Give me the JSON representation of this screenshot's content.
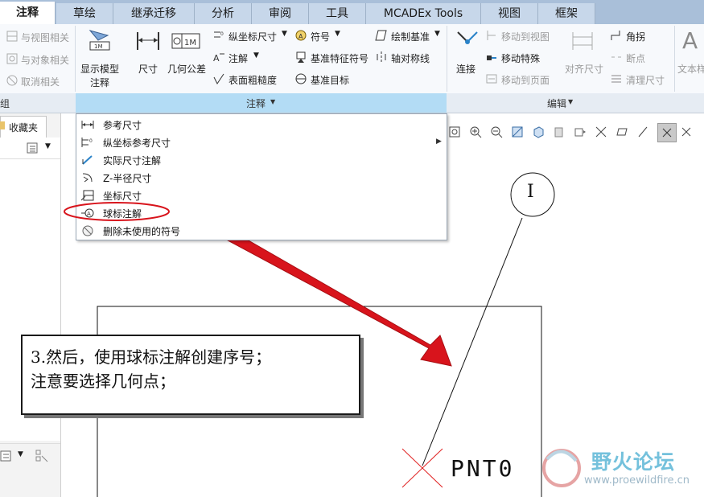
{
  "tabs": [
    "注释",
    "草绘",
    "继承迁移",
    "分析",
    "审阅",
    "工具",
    "MCADEx Tools",
    "视图",
    "框架"
  ],
  "ribbon": {
    "left_items": [
      "与视图相关",
      "与对象相关",
      "取消相关"
    ],
    "annot_group": {
      "show_model": [
        "显示模型",
        "注释"
      ],
      "dimension": "尺寸",
      "gtol": "几何公差",
      "ordinate": "纵坐标尺寸",
      "note": "注解",
      "surface_finish": "表面粗糙度",
      "symbol": "符号",
      "datum_feature": "基准特征符号",
      "datum_target": "基准目标",
      "sketch_datum": "绘制基准",
      "axis_sym": "轴对称线",
      "group_label": "注释"
    },
    "edit_group": {
      "connect": "连接",
      "move_to_view": "移动到视图",
      "move_special": "移动特殊",
      "move_to_page": "移动到页面",
      "align_dim": "对齐尺寸",
      "corner": "角拐",
      "breakpoint": "断点",
      "cleanup_dim": "清理尺寸",
      "text_style": "文本样",
      "group_label": "编辑"
    }
  },
  "left_panel": {
    "tab": "收藏夹",
    "left_group_label": "组"
  },
  "menu": {
    "items": [
      {
        "label": "参考尺寸",
        "icon": "reference-dimension-icon"
      },
      {
        "label": "纵坐标参考尺寸",
        "icon": "ordinate-reference-icon",
        "submenu": true
      },
      {
        "label": "实际尺寸注解",
        "icon": "actual-dimension-icon"
      },
      {
        "label": "Z-半径尺寸",
        "icon": "z-radius-icon"
      },
      {
        "label": "坐标尺寸",
        "icon": "coordinate-dimension-icon"
      },
      {
        "label": "球标注解",
        "icon": "balloon-note-icon",
        "highlighted": true
      },
      {
        "label": "删除未使用的符号",
        "icon": "delete-symbols-icon"
      }
    ]
  },
  "callout": {
    "line1": "3.然后，使用球标注解创建序号；",
    "line2": "注意要选择几何点；"
  },
  "drawing": {
    "point_label": "PNT0",
    "balloon_text": "I"
  },
  "watermark": {
    "name": "野火论坛",
    "url": "www.proewildfire.cn"
  },
  "colors": {
    "tab_bar": "#a9bfd9",
    "group_label_active": "#b3dcf5",
    "annotation_red": "#d8141c"
  }
}
